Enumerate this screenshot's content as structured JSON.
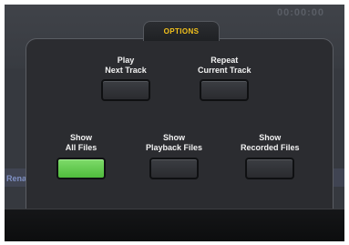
{
  "background": {
    "timecode": "00:00:00",
    "strip_text": "Renam"
  },
  "options_tab": {
    "label": "OPTIONS"
  },
  "options": {
    "play_next": {
      "line1": "Play",
      "line2": "Next Track",
      "active": false
    },
    "repeat_current": {
      "line1": "Repeat",
      "line2": "Current Track",
      "active": false
    },
    "show_all": {
      "line1": "Show",
      "line2": "All Files",
      "active": true
    },
    "show_playback": {
      "line1": "Show",
      "line2": "Playback Files",
      "active": false
    },
    "show_recorded": {
      "line1": "Show",
      "line2": "Recorded Files",
      "active": false
    }
  },
  "colors": {
    "accent_tab_text": "#f4c21c",
    "active_button": "#5fc94a",
    "panel": "#2b2c30"
  }
}
